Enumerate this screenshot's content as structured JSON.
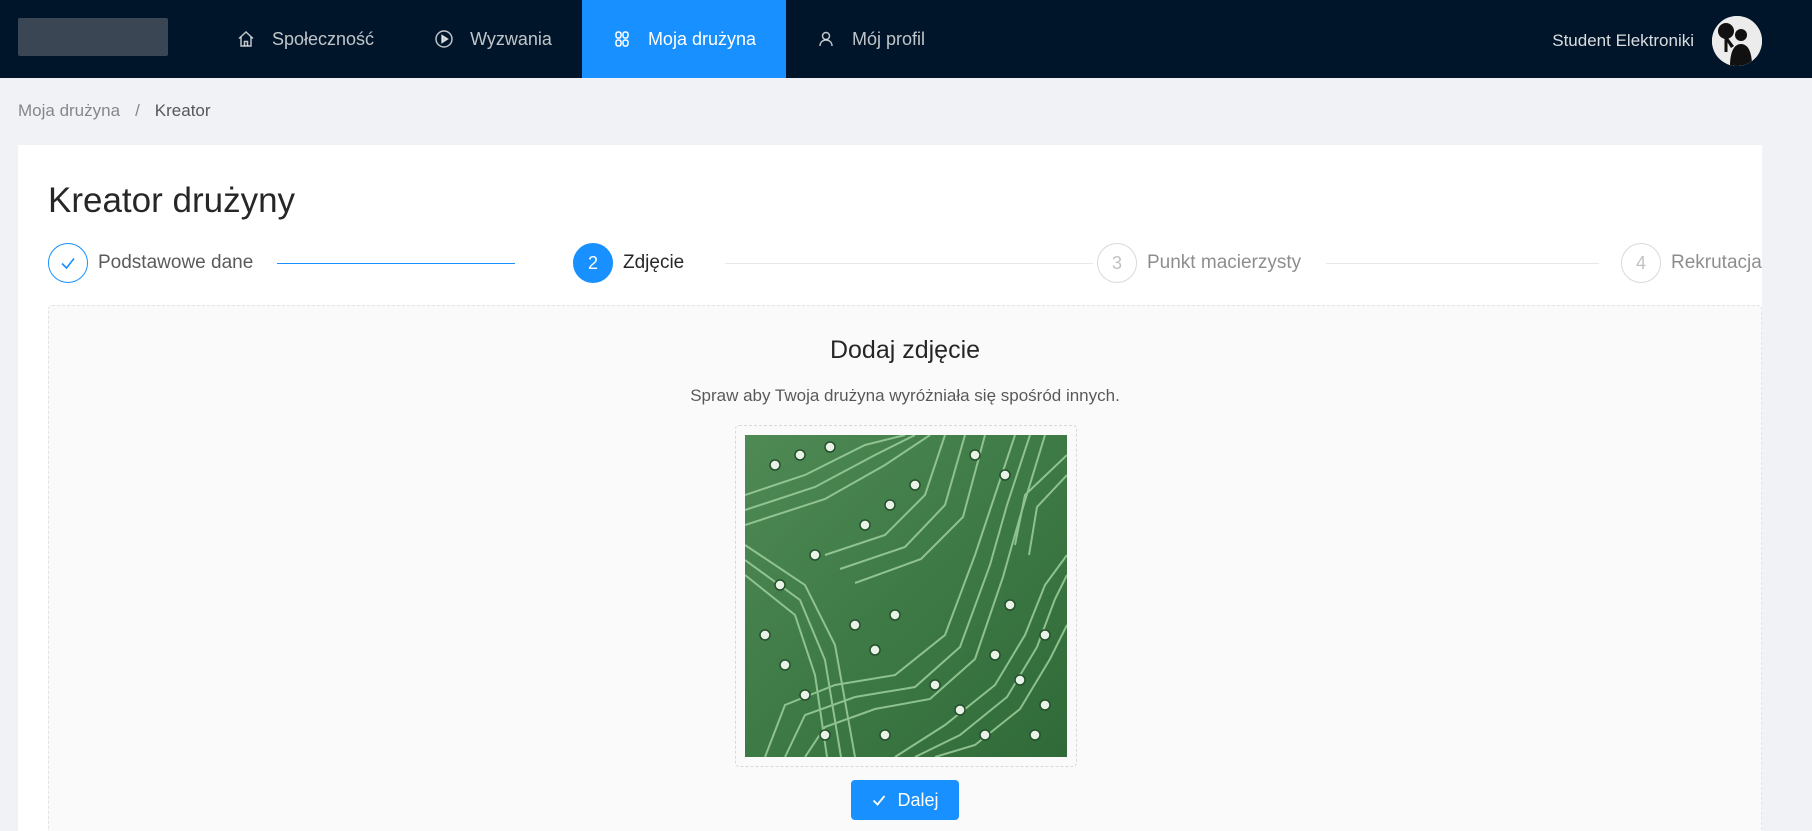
{
  "header": {
    "nav": [
      {
        "label": "Społeczność",
        "icon": "home-icon",
        "active": false
      },
      {
        "label": "Wyzwania",
        "icon": "play-circle-icon",
        "active": false
      },
      {
        "label": "Moja drużyna",
        "icon": "team-icon",
        "active": true
      },
      {
        "label": "Mój profil",
        "icon": "user-icon",
        "active": false
      }
    ],
    "user_name": "Student Elektroniki"
  },
  "breadcrumb": {
    "items": [
      "Moja drużyna",
      "Kreator"
    ],
    "separator": "/"
  },
  "page_title": "Kreator drużyny",
  "steps": [
    {
      "number": "",
      "title": "Podstawowe dane",
      "status": "finished"
    },
    {
      "number": "2",
      "title": "Zdjęcie",
      "status": "active"
    },
    {
      "number": "3",
      "title": "Punkt macierzysty",
      "status": "waiting"
    },
    {
      "number": "4",
      "title": "Rekrutacja",
      "status": "waiting"
    }
  ],
  "panel": {
    "title": "Dodaj zdjęcie",
    "subtitle": "Spraw aby Twoja drużyna wyróżniała się spośród innych.",
    "image": "circuit-board-photo"
  },
  "next_button": {
    "label": "Dalej",
    "icon": "check-icon"
  },
  "colors": {
    "primary": "#1890ff",
    "header_bg": "#001529",
    "page_bg": "#f0f2f5"
  }
}
